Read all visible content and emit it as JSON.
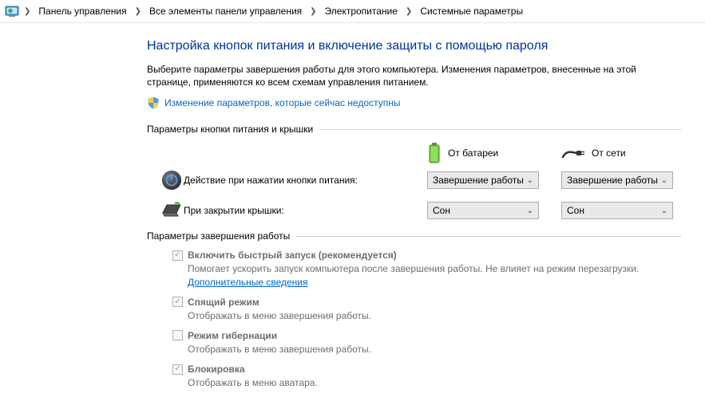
{
  "breadcrumb": {
    "items": [
      "Панель управления",
      "Все элементы панели управления",
      "Электропитание",
      "Системные параметры"
    ]
  },
  "page": {
    "title": "Настройка кнопок питания и включение защиты с помощью пароля",
    "description": "Выберите параметры завершения работы для этого компьютера. Изменения параметров, внесенные на этой странице, применяются ко всем схемам управления питанием.",
    "change_link": "Изменение параметров, которые сейчас недоступны"
  },
  "group_power": {
    "header": "Параметры кнопки питания и крышки",
    "col_battery": "От батареи",
    "col_ac": "От сети",
    "row_power_button": {
      "label": "Действие при нажатии кнопки питания:",
      "battery": "Завершение работы",
      "ac": "Завершение работы"
    },
    "row_lid": {
      "label": "При закрытии крышки:",
      "battery": "Сон",
      "ac": "Сон"
    }
  },
  "group_shutdown": {
    "header": "Параметры завершения работы",
    "items": [
      {
        "checked": true,
        "title": "Включить быстрый запуск (рекомендуется)",
        "desc_pre": "Помогает ускорить запуск компьютера после завершения работы. Не влияет на режим перезагрузки. ",
        "desc_link": "Дополнительные сведения"
      },
      {
        "checked": true,
        "title": "Спящий режим",
        "desc": "Отображать в меню завершения работы."
      },
      {
        "checked": false,
        "title": "Режим гибернации",
        "desc": "Отображать в меню завершения работы."
      },
      {
        "checked": true,
        "title": "Блокировка",
        "desc": "Отображать в меню аватара."
      }
    ]
  }
}
